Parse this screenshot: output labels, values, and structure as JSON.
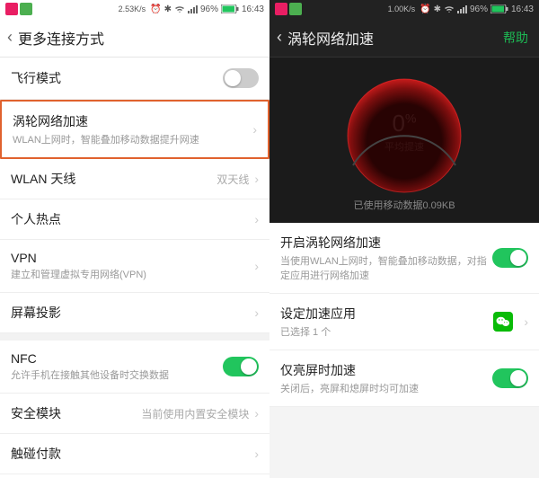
{
  "left": {
    "status": {
      "speed": "2.53K/s",
      "battery_pct": "96%",
      "time": "16:43"
    },
    "header": {
      "title": "更多连接方式"
    },
    "rows": {
      "airplane": {
        "title": "飞行模式"
      },
      "turbo": {
        "title": "涡轮网络加速",
        "sub": "WLAN上网时，智能叠加移动数据提升网速"
      },
      "wlan": {
        "title": "WLAN 天线",
        "value": "双天线"
      },
      "hotspot": {
        "title": "个人热点"
      },
      "vpn": {
        "title": "VPN",
        "sub": "建立和管理虚拟专用网络(VPN)"
      },
      "cast": {
        "title": "屏幕投影"
      },
      "nfc": {
        "title": "NFC",
        "sub": "允许手机在接触其他设备时交换数据"
      },
      "security": {
        "title": "安全模块",
        "value": "当前使用内置安全模块"
      },
      "tap": {
        "title": "触碰付款"
      }
    }
  },
  "right": {
    "status": {
      "speed": "1.00K/s",
      "battery_pct": "96%",
      "time": "16:43"
    },
    "header": {
      "title": "涡轮网络加速",
      "help": "帮助"
    },
    "gauge": {
      "value": "0",
      "unit": "%",
      "label": "平均提速"
    },
    "usage": "已使用移动数据0.09KB",
    "rows": {
      "enable": {
        "title": "开启涡轮网络加速",
        "sub": "当使用WLAN上网时，智能叠加移动数据，对指定应用进行网络加速"
      },
      "apps": {
        "title": "设定加速应用",
        "sub": "已选择 1 个"
      },
      "bright": {
        "title": "仅亮屏时加速",
        "sub": "关闭后，亮屏和熄屏时均可加速"
      }
    }
  }
}
